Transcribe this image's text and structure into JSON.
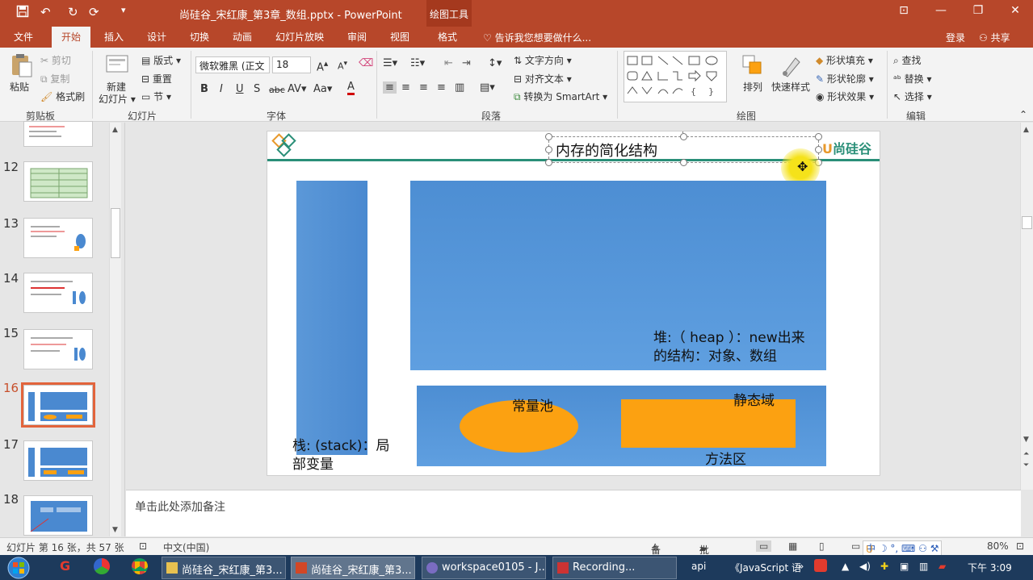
{
  "titlebar": {
    "document_title": "尚硅谷_宋红康_第3章_数组.pptx - PowerPoint",
    "context_tool": "绘图工具",
    "qa_save": "save-icon",
    "qa_undo": "undo-icon",
    "qa_redo": "redo-icon",
    "min": "—",
    "restore": "❐",
    "close": "✕",
    "ribbon_opts": "⊡"
  },
  "tabs": {
    "file": "文件",
    "home": "开始",
    "insert": "插入",
    "design": "设计",
    "transitions": "切换",
    "animations": "动画",
    "slideshow": "幻灯片放映",
    "review": "审阅",
    "view": "视图",
    "format": "格式",
    "tellme": "告诉我您想要做什么...",
    "login": "登录",
    "share": "共享"
  },
  "ribbon": {
    "clipboard": {
      "paste": "粘贴",
      "cut": "剪切",
      "copy": "复制",
      "format_painter": "格式刷",
      "label": "剪贴板"
    },
    "slides": {
      "new_slide": "新建\n幻灯片",
      "new_slide_1": "新建",
      "new_slide_2": "幻灯片",
      "layout": "版式",
      "reset": "重置",
      "section": "节",
      "label": "幻灯片"
    },
    "font": {
      "family": "微软雅黑 (正文",
      "size": "18",
      "bold": "B",
      "italic": "I",
      "underline": "U",
      "shadow": "S",
      "strike": "abc",
      "spacing": "AV",
      "case": "Aa",
      "color": "A",
      "grow": "A",
      "shrink": "A",
      "label": "字体"
    },
    "paragraph": {
      "text_direction": "文字方向",
      "align_text": "对齐文本",
      "smartart": "转换为 SmartArt",
      "label": "段落"
    },
    "drawing": {
      "arrange": "排列",
      "quick_styles": "快速样式",
      "shape_fill": "形状填充",
      "shape_outline": "形状轮廓",
      "shape_effects": "形状效果",
      "label": "绘图"
    },
    "editing": {
      "find": "查找",
      "replace": "替换",
      "select": "选择",
      "label": "编辑"
    }
  },
  "thumbnails": [
    {
      "num": "12"
    },
    {
      "num": "13"
    },
    {
      "num": "14"
    },
    {
      "num": "15"
    },
    {
      "num": "16",
      "active": true
    },
    {
      "num": "17"
    },
    {
      "num": "18"
    }
  ],
  "slide": {
    "title": "内存的简化结构",
    "logo": "尚硅谷",
    "heap_label_1": "堆:（ heap ）：new出来",
    "heap_label_2": "的结构：对象、数组",
    "constant_pool": "常量池",
    "static_area": "静态域",
    "method_area": "方法区",
    "stack_label_1": "栈: (stack)：局",
    "stack_label_2": "部变量",
    "colors": {
      "blue": "#4a89d0",
      "orange": "#fca111",
      "teal": "#2a8f78"
    }
  },
  "notes": {
    "placeholder": "单击此处添加备注"
  },
  "statusbar": {
    "slide_info": "幻灯片 第 16 张，共 57 张",
    "language": "中文(中国)",
    "notes": "备注",
    "comments": "批注",
    "zoom": "80%"
  },
  "taskbar": {
    "items": [
      "尚硅谷_宋红康_第3...",
      "尚硅谷_宋红康_第3...",
      "workspace0105 - J...",
      "Recording..."
    ],
    "tray_api": "api",
    "tray_js": "《JavaScript 语",
    "time": "下午 3:09"
  }
}
